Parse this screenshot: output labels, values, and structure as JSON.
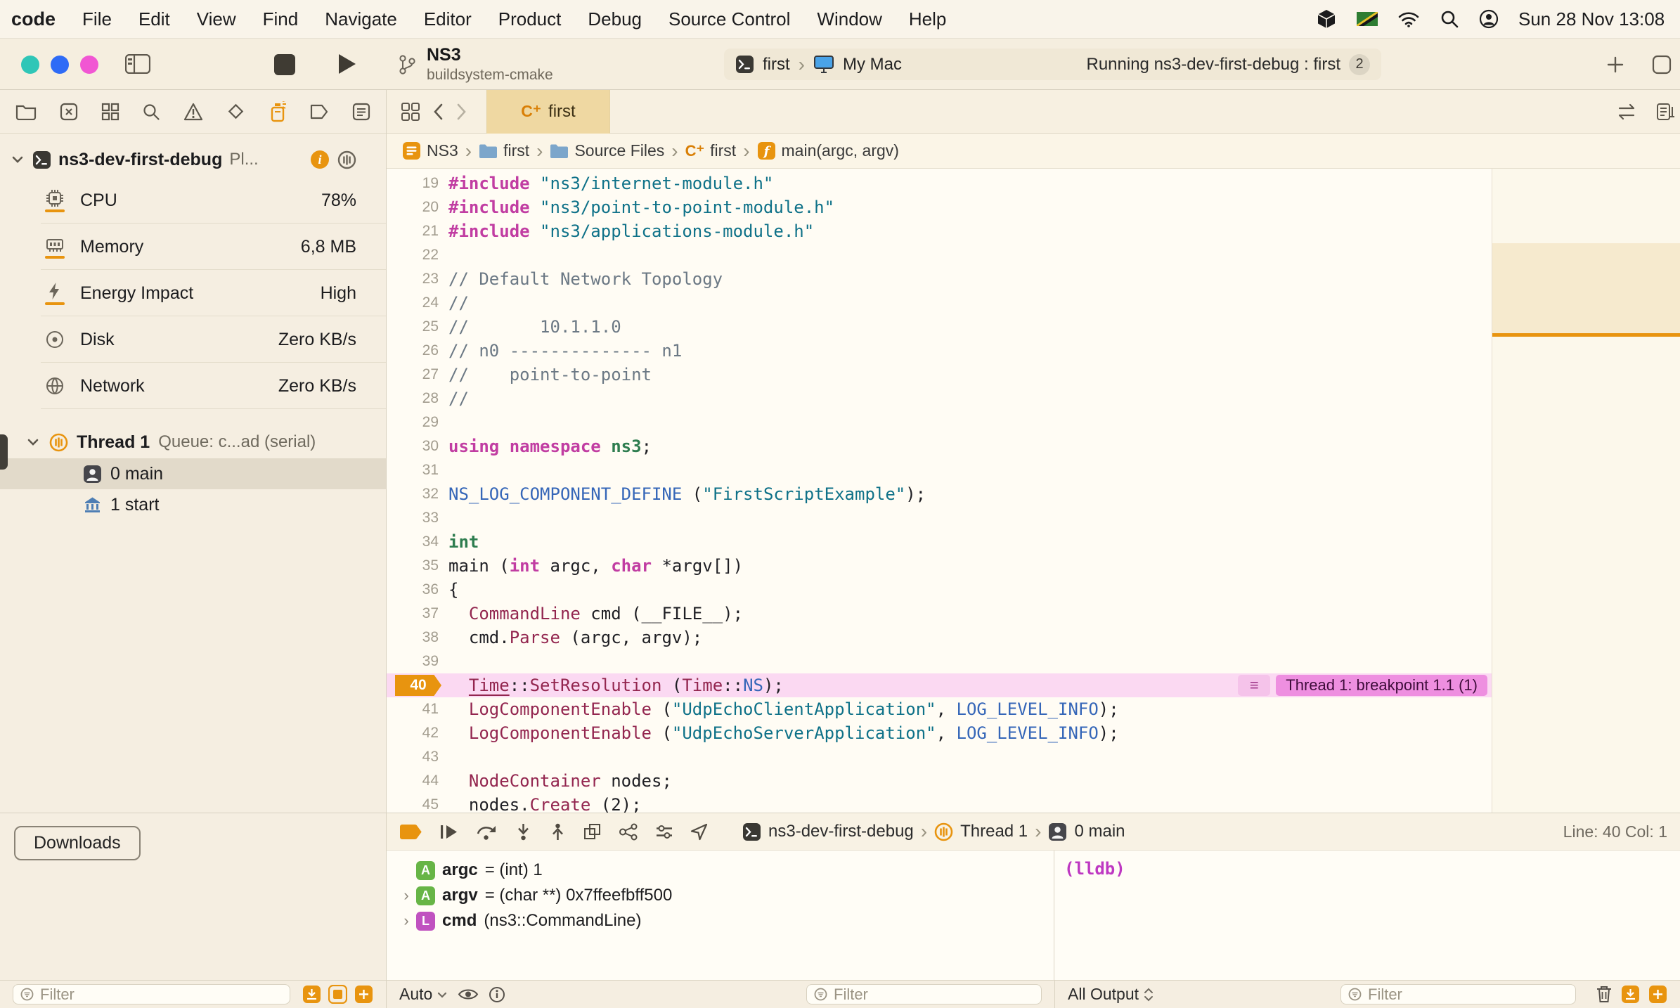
{
  "colors": {
    "accent-orange": "#E8940F",
    "breakpoint-pink": "#EE8FE0",
    "breakpoint-line": "#FBD9F2",
    "traffic-1": "#2FC6B7",
    "traffic-2": "#2E6BF6",
    "traffic-3": "#F156D3",
    "lldb-magenta": "#BE38C2"
  },
  "icons_text": {
    "chevron_right": "›",
    "hamburger": "≡"
  },
  "menu_bar": {
    "app_name": "code",
    "menus": [
      "File",
      "Edit",
      "View",
      "Find",
      "Navigate",
      "Editor",
      "Product",
      "Debug",
      "Source Control",
      "Window",
      "Help"
    ],
    "clock": "Sun 28 Nov 13:08"
  },
  "toolbar": {
    "scheme_name": "NS3",
    "scheme_subtitle": "buildsystem-cmake",
    "run_destination": {
      "target": "first",
      "device": "My Mac"
    },
    "activity": {
      "text": "Running ns3-dev-first-debug : first",
      "badge": "2"
    }
  },
  "navigator": {
    "process_row": {
      "name": "ns3-dev-first-debug",
      "truncated": "Pl..."
    },
    "gauges": [
      {
        "icon": "cpu-icon",
        "label": "CPU",
        "value": "78%",
        "bar": true
      },
      {
        "icon": "memory-icon",
        "label": "Memory",
        "value": "6,8 MB",
        "bar": true
      },
      {
        "icon": "energy-icon",
        "label": "Energy Impact",
        "value": "High",
        "bar": true
      },
      {
        "icon": "disk-icon",
        "label": "Disk",
        "value": "Zero KB/s",
        "bar": false
      },
      {
        "icon": "network-icon",
        "label": "Network",
        "value": "Zero KB/s",
        "bar": false
      }
    ],
    "thread_row": {
      "label": "Thread 1",
      "detail": "Queue: c...ad (serial)"
    },
    "frames": [
      {
        "icon": "person",
        "label": "0 main",
        "selected": true
      },
      {
        "icon": "bank",
        "label": "1 start",
        "selected": false
      }
    ],
    "downloads_label": "Downloads",
    "filter_placeholder": "Filter"
  },
  "tab_bar": {
    "active_tab": {
      "glyph": "C⁺",
      "label": "first"
    }
  },
  "jump_bar": {
    "items": [
      {
        "icon": "app",
        "label": "NS3"
      },
      {
        "icon": "folder",
        "label": "first"
      },
      {
        "icon": "folder",
        "label": "Source Files"
      },
      {
        "icon": "cpp",
        "glyph": "C⁺",
        "label": "first"
      },
      {
        "icon": "func",
        "label": "main(argc, argv)"
      }
    ]
  },
  "editor": {
    "breakpoint_line": 40,
    "breakpoint_annotation": "Thread 1: breakpoint 1.1 (1)",
    "lines": [
      {
        "n": 19,
        "s": [
          [
            "k",
            "#include"
          ],
          [
            "p",
            " "
          ],
          [
            "s",
            "\"ns3/internet-module.h\""
          ]
        ]
      },
      {
        "n": 20,
        "s": [
          [
            "k",
            "#include"
          ],
          [
            "p",
            " "
          ],
          [
            "s",
            "\"ns3/point-to-point-module.h\""
          ]
        ]
      },
      {
        "n": 21,
        "s": [
          [
            "k",
            "#include"
          ],
          [
            "p",
            " "
          ],
          [
            "s",
            "\"ns3/applications-module.h\""
          ]
        ]
      },
      {
        "n": 22,
        "s": []
      },
      {
        "n": 23,
        "s": [
          [
            "c",
            "// Default Network Topology"
          ]
        ]
      },
      {
        "n": 24,
        "s": [
          [
            "c",
            "//"
          ]
        ]
      },
      {
        "n": 25,
        "s": [
          [
            "c",
            "//       10.1.1.0"
          ]
        ]
      },
      {
        "n": 26,
        "s": [
          [
            "c",
            "// n0 -------------- n1"
          ]
        ]
      },
      {
        "n": 27,
        "s": [
          [
            "c",
            "//    point-to-point"
          ]
        ]
      },
      {
        "n": 28,
        "s": [
          [
            "c",
            "//"
          ]
        ]
      },
      {
        "n": 29,
        "s": []
      },
      {
        "n": 30,
        "s": [
          [
            "k",
            "using"
          ],
          [
            "p",
            " "
          ],
          [
            "k",
            "namespace"
          ],
          [
            "p",
            " "
          ],
          [
            "n",
            "ns3"
          ],
          [
            "p",
            ";"
          ]
        ]
      },
      {
        "n": 31,
        "s": []
      },
      {
        "n": 32,
        "s": [
          [
            "b",
            "NS_LOG_COMPONENT_DEFINE"
          ],
          [
            "p",
            " ("
          ],
          [
            "s",
            "\"FirstScriptExample\""
          ],
          [
            "p",
            ");"
          ]
        ]
      },
      {
        "n": 33,
        "s": []
      },
      {
        "n": 34,
        "s": [
          [
            "n",
            "int"
          ]
        ]
      },
      {
        "n": 35,
        "s": [
          [
            "p",
            "main ("
          ],
          [
            "k",
            "int"
          ],
          [
            "p",
            " argc, "
          ],
          [
            "k",
            "char"
          ],
          [
            "p",
            " *argv[])"
          ]
        ]
      },
      {
        "n": 36,
        "s": [
          [
            "p",
            "{"
          ]
        ]
      },
      {
        "n": 37,
        "s": [
          [
            "p",
            "  "
          ],
          [
            "t",
            "CommandLine"
          ],
          [
            "p",
            " cmd (__FILE__);"
          ]
        ]
      },
      {
        "n": 38,
        "s": [
          [
            "p",
            "  cmd."
          ],
          [
            "t",
            "Parse"
          ],
          [
            "p",
            " (argc, argv);"
          ]
        ]
      },
      {
        "n": 39,
        "s": []
      },
      {
        "n": 40,
        "s": [
          [
            "p",
            "  "
          ],
          [
            "u",
            "Time"
          ],
          [
            "p",
            "::"
          ],
          [
            "t",
            "SetResolution"
          ],
          [
            "p",
            " ("
          ],
          [
            "t",
            "Time"
          ],
          [
            "p",
            "::"
          ],
          [
            "b",
            "NS"
          ],
          [
            "p",
            ");"
          ]
        ]
      },
      {
        "n": 41,
        "s": [
          [
            "p",
            "  "
          ],
          [
            "t",
            "LogComponentEnable"
          ],
          [
            "p",
            " ("
          ],
          [
            "s",
            "\"UdpEchoClientApplication\""
          ],
          [
            "p",
            ", "
          ],
          [
            "b",
            "LOG_LEVEL_INFO"
          ],
          [
            "p",
            ");"
          ]
        ]
      },
      {
        "n": 42,
        "s": [
          [
            "p",
            "  "
          ],
          [
            "t",
            "LogComponentEnable"
          ],
          [
            "p",
            " ("
          ],
          [
            "s",
            "\"UdpEchoServerApplication\""
          ],
          [
            "p",
            ", "
          ],
          [
            "b",
            "LOG_LEVEL_INFO"
          ],
          [
            "p",
            ");"
          ]
        ]
      },
      {
        "n": 43,
        "s": []
      },
      {
        "n": 44,
        "s": [
          [
            "p",
            "  "
          ],
          [
            "t",
            "NodeContainer"
          ],
          [
            "p",
            " nodes;"
          ]
        ]
      },
      {
        "n": 45,
        "s": [
          [
            "p",
            "  nodes."
          ],
          [
            "t",
            "Create"
          ],
          [
            "p",
            " (2);"
          ]
        ]
      }
    ]
  },
  "debug_bar": {
    "process": "ns3-dev-first-debug",
    "thread": "Thread 1",
    "frame": "0 main",
    "position": "Line: 40  Col: 1"
  },
  "variables_view": {
    "rows": [
      {
        "expand": false,
        "badge": "A",
        "badge_color": "#67B546",
        "name": "argc",
        "value": "= (int) 1"
      },
      {
        "expand": true,
        "badge": "A",
        "badge_color": "#67B546",
        "name": "argv",
        "value": "= (char **) 0x7ffeefbff500"
      },
      {
        "expand": true,
        "badge": "L",
        "badge_color": "#C052C0",
        "name": "cmd",
        "value": "(ns3::CommandLine)"
      }
    ],
    "scope_selector": "Auto",
    "filter_placeholder": "Filter"
  },
  "console": {
    "prompt": "(lldb)",
    "output_selector": "All Output",
    "filter_placeholder": "Filter"
  }
}
